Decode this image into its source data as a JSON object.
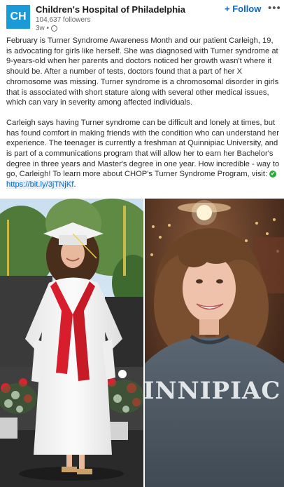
{
  "header": {
    "logo_text": "CH",
    "org_name": "Children's Hospital of Philadelphia",
    "followers": "104,637 followers",
    "timestamp": "3w •",
    "follow_label": "+ Follow",
    "more_label": "•••"
  },
  "post": {
    "paragraph1": "February is Turner Syndrome Awareness Month and our patient Carleigh, 19, is advocating for girls like herself. She was diagnosed with Turner syndrome at 9-years-old when her parents and doctors noticed her growth wasn't where it should be. After a number of tests, doctors found that a part of her X chromosome was missing. Turner syndrome is a chromosomal disorder in girls that is associated with short stature along with several other medical issues, which can vary in severity among affected individuals.",
    "paragraph2": "Carleigh says having Turner syndrome can be difficult and lonely at times, but has found comfort in making friends with the condition who can understand her experience. The teenager is currently a freshman at Quinnipiac University, and is part of a communications program that will allow her to earn her Bachelor's degree in three years and Master's degree in one year. How incredible - way to go, Carleigh! To learn more about CHOP's Turner Syndrome Program, visit:",
    "check_icon": "✔",
    "link_text": "https://bit.ly/3jTNjKf",
    "link_suffix": "."
  },
  "images": {
    "left": "graduation-photo",
    "right": "portrait-photo",
    "sweatshirt_text": "INNIPIAC"
  },
  "colors": {
    "brand": "#1a9ad6",
    "follow": "#0a66c2",
    "gown": "#f7f7f7",
    "stole": "#d81e2c"
  }
}
